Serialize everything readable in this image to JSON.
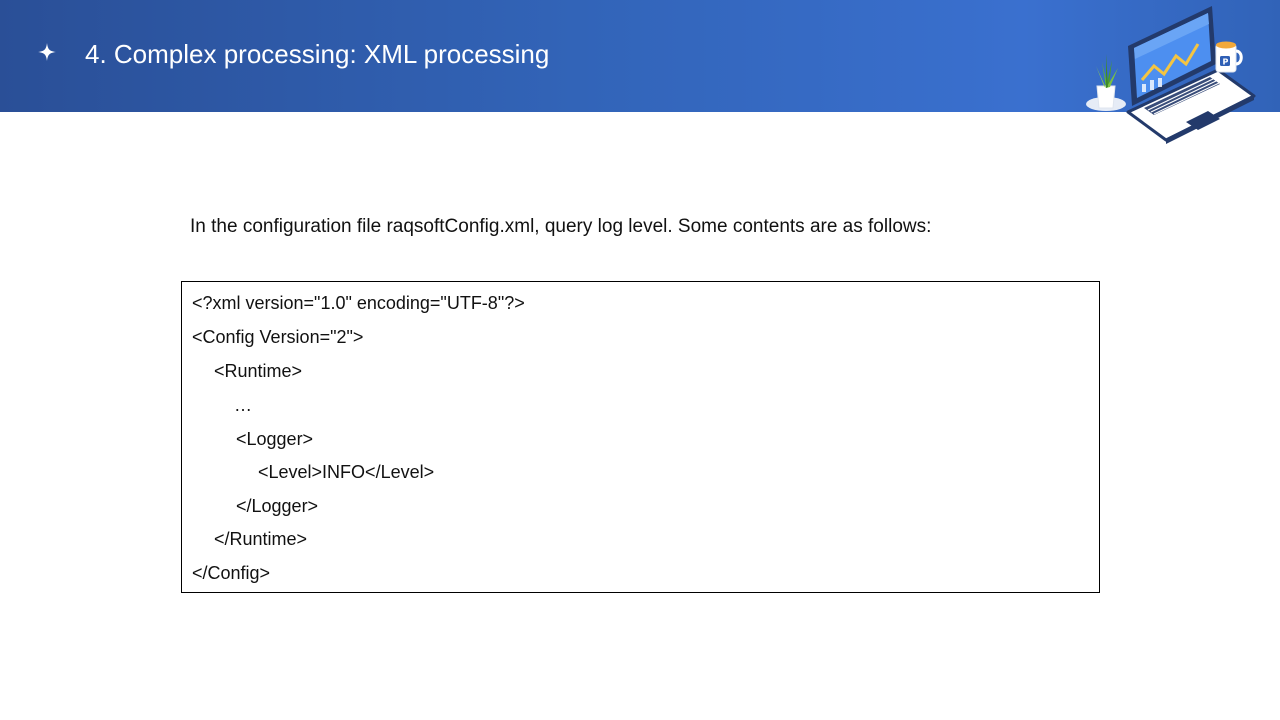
{
  "header": {
    "title": "4. Complex processing: XML processing"
  },
  "content": {
    "intro": "In the configuration file raqsoftConfig.xml, query log level. Some contents are as follows:",
    "code_lines": [
      "<?xml version=\"1.0\" encoding=\"UTF-8\"?>",
      "<Config Version=\"2\">",
      "<Runtime>",
      "…",
      "<Logger>",
      "<Level>INFO</Level>",
      "</Logger>",
      "</Runtime>",
      "</Config>"
    ]
  },
  "colors": {
    "banner_start": "#2a4f97",
    "banner_end": "#3a70cf",
    "title_text": "#ffffff",
    "body_text": "#111111"
  },
  "icons": {
    "bullet": "four-point-star-icon",
    "illustration": "laptop-illustration"
  }
}
